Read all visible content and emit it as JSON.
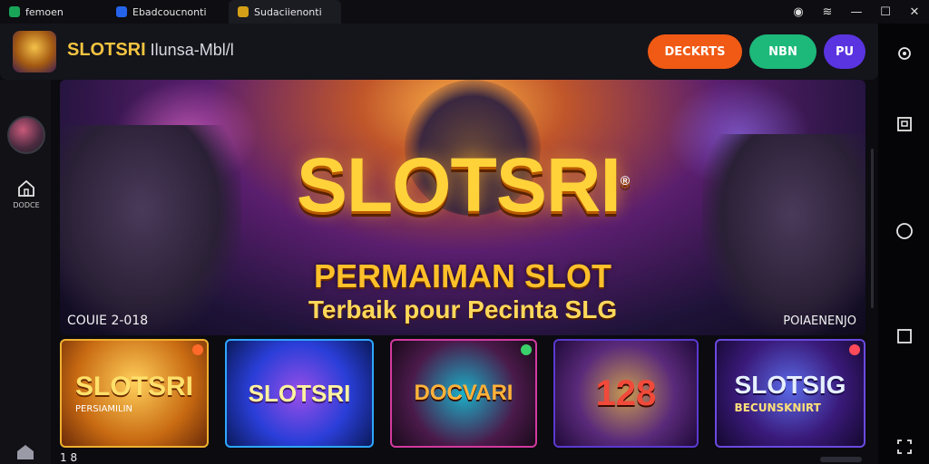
{
  "tabs": [
    {
      "label": "femoen",
      "icon": "app-icon",
      "color": "#18a558"
    },
    {
      "label": "Ebadcoucnonti",
      "icon": "blue-app-icon",
      "color": "#2563eb"
    },
    {
      "label": "Sudaciienonti",
      "icon": "gold-app-icon",
      "color": "#d4a017"
    }
  ],
  "header": {
    "brand_primary": "SLOTSRI",
    "brand_secondary": " Ilunsa-Mbl/l",
    "buttons": {
      "deposit": "DECKRTS",
      "new": "NBN",
      "profile": "PU"
    }
  },
  "sidebar": {
    "home_label": "DODCE"
  },
  "hero": {
    "title": "SLOTSRI",
    "trademark": "®",
    "subtitle": "PERMAIMAN SLOT",
    "tagline": "Terbaik pour Pecinta SLG",
    "footer_left": "COUIE 2-018",
    "footer_right": "POIAENENJO"
  },
  "games": [
    {
      "title": "SLOTSRI",
      "subtitle": "PERSIAMILIN"
    },
    {
      "title": "SLOTSRI",
      "subtitle": ""
    },
    {
      "title": "DOCVARI",
      "subtitle": ""
    },
    {
      "title": "128",
      "subtitle": ""
    },
    {
      "title": "SLOTSIG",
      "subtitle": "BECUNSKNIRT"
    }
  ],
  "pager": {
    "text": "1 8"
  },
  "colors": {
    "deposit_button": "#f15a14",
    "new_button": "#1db97a",
    "profile_button": "#5a34e0",
    "brand_gold": "#f3c440"
  }
}
